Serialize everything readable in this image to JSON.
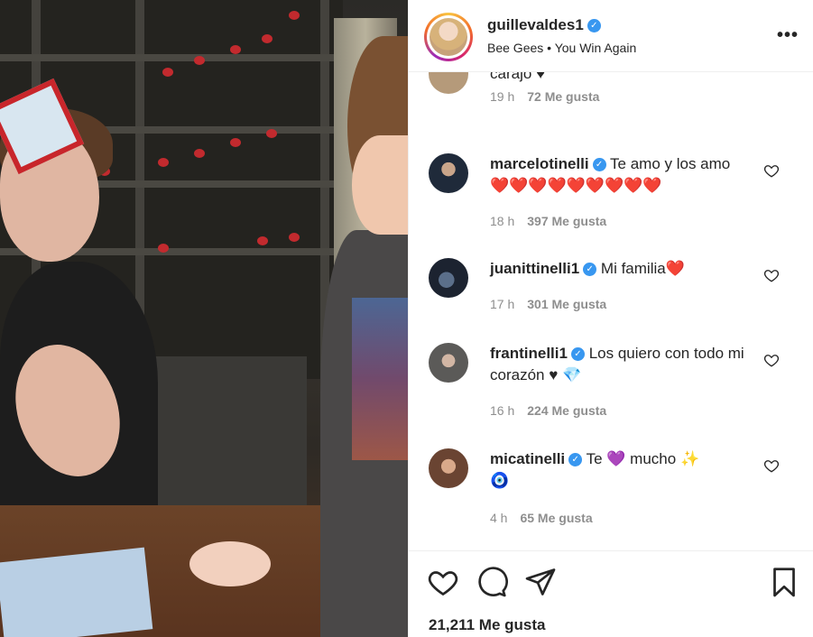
{
  "header": {
    "username": "guillevaldes1",
    "music": "Bee Gees • You Win Again",
    "more_label": "•••"
  },
  "comments": [
    {
      "id": "c0",
      "username": "",
      "text": "carajo ♥",
      "time": "19 h",
      "likes": "72 Me gusta",
      "verified": false
    },
    {
      "id": "c1",
      "username": "marcelotinelli",
      "text": "Te amo y los amo",
      "emoji": "❤️❤️❤️❤️❤️❤️❤️❤️❤️",
      "time": "18 h",
      "likes": "397 Me gusta",
      "verified": true
    },
    {
      "id": "c2",
      "username": "juanittinelli1",
      "text": "Mi familia",
      "emoji": "❤️",
      "time": "17 h",
      "likes": "301 Me gusta",
      "verified": true
    },
    {
      "id": "c3",
      "username": "frantinelli1",
      "text": "Los quiero con todo mi corazón ♥",
      "emoji": "💎",
      "time": "16 h",
      "likes": "224 Me gusta",
      "verified": true
    },
    {
      "id": "c4",
      "username": "micatinelli",
      "text_before": "Te",
      "emoji_mid": "💜",
      "text_after": "mucho",
      "emoji_end": "✨",
      "emoji_line2": "🧿",
      "time": "4 h",
      "likes": "65 Me gusta",
      "verified": true
    }
  ],
  "footer": {
    "likes_total": "21,211 Me gusta"
  },
  "colors": {
    "text": "#262626",
    "meta": "#8e8e8e",
    "verified": "#3897f0",
    "heart_red": "#e0222f",
    "border": "#efefef"
  },
  "icons": [
    "verified-badge-icon",
    "more-options-icon",
    "like-comment-heart-icon",
    "like-heart-icon",
    "comment-bubble-icon",
    "share-paper-plane-icon",
    "save-bookmark-icon"
  ]
}
